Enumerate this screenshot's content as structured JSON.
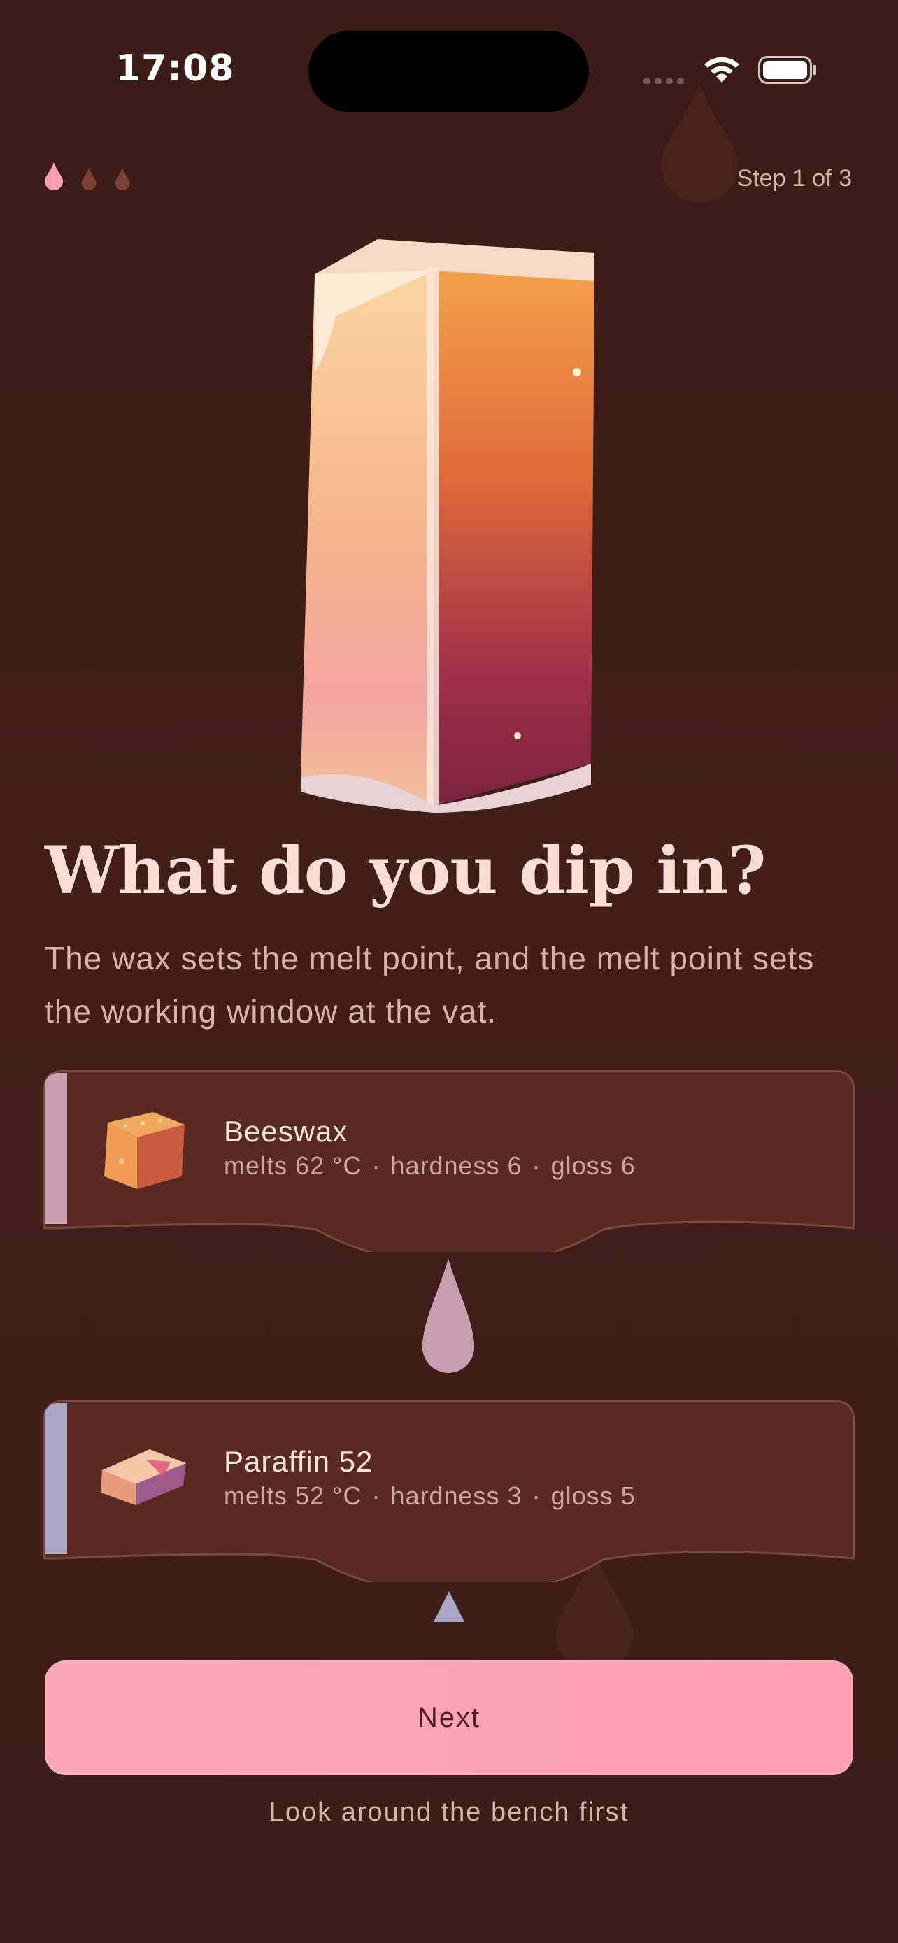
{
  "status_bar": {
    "time": "17:08"
  },
  "progress": {
    "label": "Step 1 of 3",
    "current": 1,
    "total": 3
  },
  "heading": {
    "title": "What do you dip in?",
    "subtitle": "The wax sets the melt point, and the melt point sets the working window at the vat."
  },
  "options": [
    {
      "name": "Beeswax",
      "melts": "melts 62 °C",
      "hardness": "hardness 6",
      "gloss": "gloss 6",
      "accent": "#c8a0b2"
    },
    {
      "name": "Paraffin 52",
      "melts": "melts 52 °C",
      "hardness": "hardness 3",
      "gloss": "gloss 5",
      "accent": "#a8a6c4"
    }
  ],
  "actions": {
    "next_label": "Next",
    "secondary_link": "Look around the bench first"
  },
  "colors": {
    "background": "#3f1d18",
    "card": "#5a2922",
    "primary_button": "#fca5b4",
    "title": "#fcded4"
  },
  "icons": [
    "wifi-icon",
    "battery-icon",
    "drop-icon"
  ]
}
